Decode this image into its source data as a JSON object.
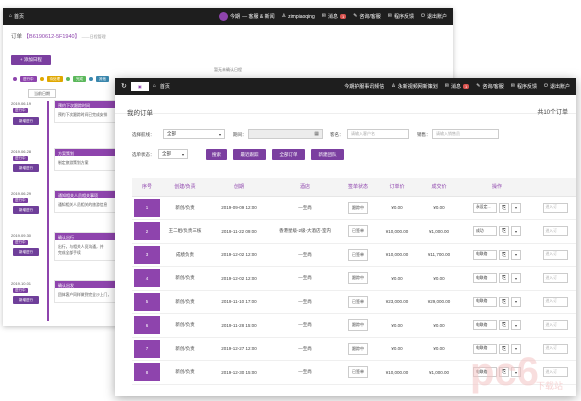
{
  "colors": {
    "accent": "#8e44ad",
    "topbar": "#1e1e1e",
    "alert": "#d9534f",
    "watermark": "#f3b3b3"
  },
  "back_window": {
    "topbar": {
      "home": "首页",
      "greeting": "今期",
      "greeting_extra": "—  客服 & 新闻",
      "username": "zimpiaoqing",
      "messages": "消息",
      "messages_badge": "1",
      "chat": "咨询/客服",
      "feedback": "程序反馈",
      "logout": "退出账户"
    },
    "order_title_prefix": "订单",
    "order_id": "【B6190612-5F1940】",
    "order_title_sub": "——日程管理",
    "add_log_button": "+ 添加日程",
    "hint": "暂无未确认日程",
    "legend": [
      {
        "label": "进行中",
        "color": "#8e44ad"
      },
      {
        "label": "待处理",
        "color": "#e0a800"
      },
      {
        "label": "完成",
        "color": "#5cb85c"
      },
      {
        "label": "其他",
        "color": "#3a87ad"
      }
    ],
    "log_date_button": "当前日期",
    "entries": [
      {
        "date": "2019.06.19",
        "badge": "进行中",
        "button": "新增进行",
        "title": "预约下次跟踪时间",
        "body": "预约下次跟踪时间已完成安排"
      },
      {
        "date": "2019.06.28",
        "badge": "进行中",
        "button": "新增进行",
        "title": "方案策划",
        "body": "制定旅游策划方案"
      },
      {
        "date": "2019.06.29",
        "badge": "进行中",
        "button": "新增进行",
        "title": "通知相关人员相关事项",
        "body": "通知相关人员相关的旅游信息"
      },
      {
        "date": "2019.09.30",
        "badge": "进行中",
        "button": "新增进行",
        "title": "确认出行",
        "body": "出行，与相关人员沟通，并",
        "body2": "完成全部手续"
      },
      {
        "date": "2019.10.01",
        "badge": "进行中",
        "button": "新增进行",
        "title": "确认出发",
        "body": "团体客户同样做到完全沙上门，",
        "body2": ""
      }
    ]
  },
  "front_window": {
    "topbar": {
      "home": "首页",
      "greeting": "今期护服事讯频信",
      "account": "永新视频网新策划",
      "messages": "消息",
      "messages_badge": "1",
      "chat": "咨询/客服",
      "feedback": "程序反馈",
      "logout": "退出账户"
    },
    "page_title": "我的订单",
    "order_count": "共10个订单",
    "filters": {
      "route_label": "选择航线：",
      "route_value": "全部",
      "date_label": "期间：",
      "customer_label": "客名：",
      "customer_placeholder": "请输入客户名",
      "sales_label": "销售：",
      "sales_placeholder": "请输入销售员",
      "status_label": "选单状态：",
      "status_value": "全部",
      "buttons": [
        "搜索",
        "最近跟踪",
        "全部订单",
        "新建团队"
      ]
    },
    "table": {
      "headers": [
        "序号",
        "创建/负责",
        "创期",
        "酒店",
        "签单状态",
        "订单价",
        "成交价",
        "操作"
      ],
      "rows": [
        {
          "seq": "1",
          "owner": "新创/负责",
          "date": "2019-09-09 12:00",
          "hotel": "—至尚",
          "status": "跟踪中",
          "price": "¥0.00",
          "deal": "¥0.00",
          "op": "永设定...",
          "extra": "进入订"
        },
        {
          "seq": "2",
          "owner": "王二姐/负责三核",
          "date": "2019-11-22 09:00",
          "hotel": "香港星级-2级-大酒店-室内",
          "status": "已签单",
          "price": "¥10,000.00",
          "deal": "¥1,000.00",
          "op": "成功",
          "extra": "进入订"
        },
        {
          "seq": "3",
          "owner": "成绩负责",
          "date": "2019-12-02 12:00",
          "hotel": "—至尚",
          "status": "已签单",
          "price": "¥10,000.00",
          "deal": "¥11,700.00",
          "op": "电联络",
          "extra": "进入订"
        },
        {
          "seq": "4",
          "owner": "新创/负责",
          "date": "2019-12-02 12:00",
          "hotel": "—至尚",
          "status": "跟踪中",
          "price": "¥0.00",
          "deal": "¥0.00",
          "op": "电联络",
          "extra": "进入订"
        },
        {
          "seq": "5",
          "owner": "新创/负责",
          "date": "2019-11-10 17:00",
          "hotel": "—至尚",
          "status": "已签单",
          "price": "¥23,000.00",
          "deal": "¥29,000.00",
          "op": "电联络",
          "extra": "进入订"
        },
        {
          "seq": "6",
          "owner": "新创/负责",
          "date": "2019-11-28 15:00",
          "hotel": "—至尚",
          "status": "跟踪中",
          "price": "¥0.00",
          "deal": "¥0.00",
          "op": "电联络",
          "extra": "进入订"
        },
        {
          "seq": "7",
          "owner": "新创/负责",
          "date": "2019-12-27 12:00",
          "hotel": "—至尚",
          "status": "跟踪中",
          "price": "¥0.00",
          "deal": "¥0.00",
          "op": "电联络",
          "extra": "进入订"
        },
        {
          "seq": "8",
          "owner": "新创/负责",
          "date": "2019-12-30 15:00",
          "hotel": "—至尚",
          "status": "已签单",
          "price": "¥10,000.00",
          "deal": "¥1,000.00",
          "op": "电联络",
          "extra": "进入订"
        }
      ]
    }
  },
  "watermark": {
    "brand": "pc6",
    "sub": "下载站"
  }
}
